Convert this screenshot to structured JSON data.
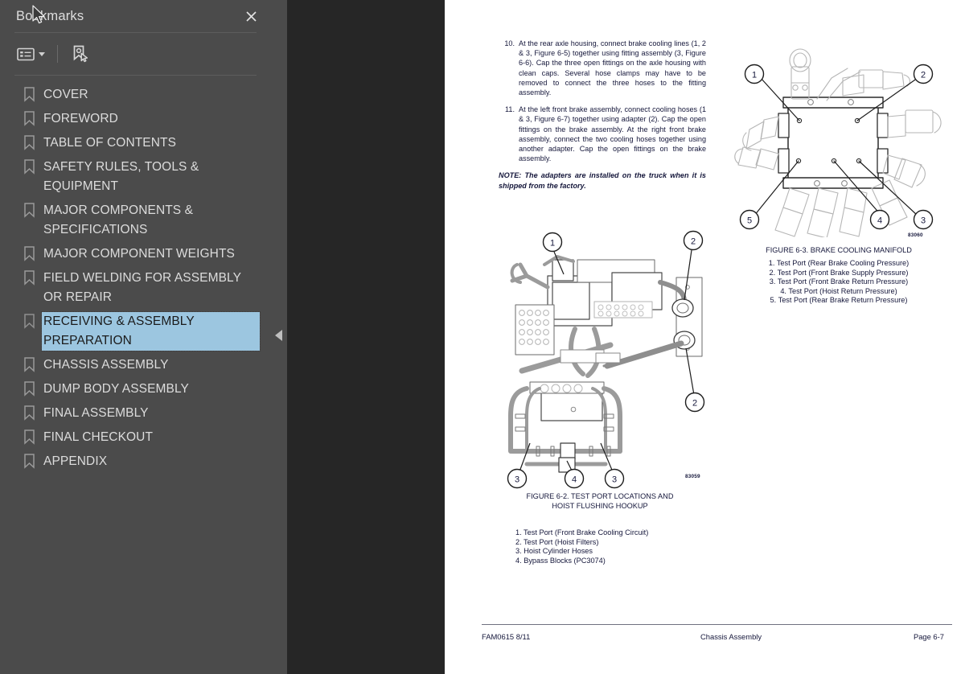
{
  "sidebar": {
    "title": "Bookmarks",
    "close_icon": "close-icon",
    "toolbar": {
      "options_label": "list-options",
      "options_icon": "list-options-icon",
      "dropdown_icon": "chevron-down-icon",
      "new_bookmark_icon": "new-bookmark-icon"
    },
    "collapse_icon": "collapse-left-icon",
    "items": [
      {
        "label": "COVER",
        "selected": false
      },
      {
        "label": "FOREWORD",
        "selected": false
      },
      {
        "label": "TABLE OF CONTENTS",
        "selected": false
      },
      {
        "label": "SAFETY RULES, TOOLS & EQUIPMENT",
        "selected": false
      },
      {
        "label": "MAJOR COMPONENTS & SPECIFICATIONS",
        "selected": false
      },
      {
        "label": "MAJOR COMPONENT WEIGHTS",
        "selected": false
      },
      {
        "label": "FIELD WELDING FOR ASSEMBLY OR REPAIR",
        "selected": false
      },
      {
        "label": "RECEIVING & ASSEMBLY PREPARATION",
        "selected": true
      },
      {
        "label": "CHASSIS ASSEMBLY",
        "selected": false
      },
      {
        "label": "DUMP BODY ASSEMBLY",
        "selected": false
      },
      {
        "label": "FINAL ASSEMBLY",
        "selected": false
      },
      {
        "label": "FINAL CHECKOUT",
        "selected": false
      },
      {
        "label": "APPENDIX",
        "selected": false
      }
    ]
  },
  "page": {
    "instructions": [
      {
        "number": "10.",
        "text": "At the rear axle housing, connect brake cooling lines (1, 2 & 3, Figure 6-5) together using fitting assembly (3, Figure 6-6). Cap the three open fittings on the axle housing with clean caps. Several hose clamps may have to be removed to connect the three hoses to the fitting assembly."
      },
      {
        "number": "11.",
        "text": "At the left front brake assembly, connect cooling hoses (1 & 3, Figure 6-7) together using adapter (2). Cap the open fittings on the brake assembly. At the right front brake assembly, connect the two cooling hoses together using another adapter. Cap the open fittings on the brake assembly."
      }
    ],
    "note": "NOTE: The adapters are installed on the truck when it is shipped from the factory.",
    "figure_6_3": {
      "drawing_number": "83060",
      "caption": "FIGURE 6-3. BRAKE COOLING MANIFOLD",
      "callouts": [
        "1",
        "2",
        "3",
        "4",
        "5"
      ],
      "legend": [
        "1. Test Port (Rear Brake Cooling Pressure)",
        "2. Test Port (Front Brake Supply Pressure)",
        "3. Test Port (Front Brake Return Pressure)",
        "4. Test Port (Hoist Return Pressure)",
        "5. Test Port (Rear Brake Return Pressure)"
      ]
    },
    "figure_6_2": {
      "drawing_number": "83059",
      "caption_line1": "FIGURE 6-2. TEST PORT LOCATIONS AND",
      "caption_line2": "HOIST FLUSHING HOOKUP",
      "callouts": [
        "1",
        "2",
        "2",
        "3",
        "4",
        "3"
      ],
      "legend": [
        "1. Test Port (Front Brake Cooling Circuit)",
        "2. Test Port (Hoist Filters)",
        "3. Hoist Cylinder Hoses",
        "4. Bypass Blocks (PC3074)"
      ]
    },
    "footer": {
      "left": "FAM0615   8/11",
      "center": "Chassis Assembly",
      "right": "Page 6-7"
    }
  },
  "colors": {
    "sidebar_bg": "#4b4b4b",
    "viewer_bg": "#262626",
    "page_bg": "#ffffff",
    "selection_bg": "#9cc6e0",
    "text_light": "#dcdcdc",
    "doc_text": "#15173b"
  }
}
